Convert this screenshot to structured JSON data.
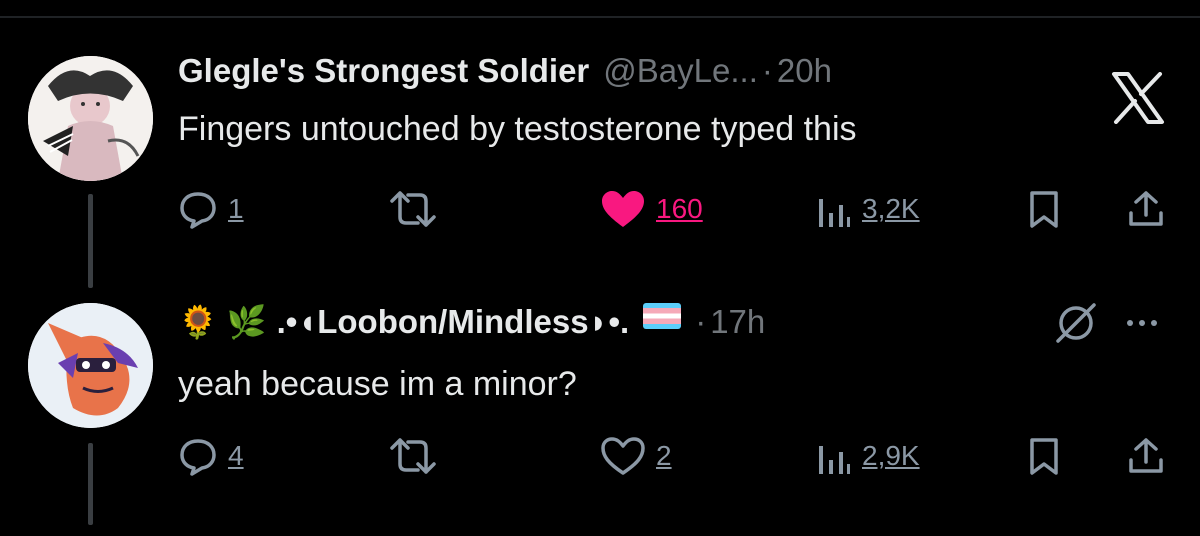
{
  "tweets": [
    {
      "author_name": "Glegle's Strongest Soldier",
      "handle": "@BayLe...",
      "separator": "·",
      "time": "20h",
      "text": "Fingers untouched by testosterone typed this",
      "replies": "1",
      "likes": "160",
      "liked": true,
      "views": "3,2K"
    },
    {
      "emoji_prefix": "🌻 🌿",
      "author_name": ".•◖Loobon/Mindless◗•.",
      "separator": "·",
      "time": "17h",
      "text": "yeah because im a minor?",
      "replies": "4",
      "likes": "2",
      "liked": false,
      "views": "2,9K"
    }
  ],
  "icons": {
    "reply": "speech-bubble-icon",
    "retweet": "retweet-icon",
    "like": "heart-icon",
    "views": "bar-chart-icon",
    "bookmark": "bookmark-icon",
    "share": "share-icon",
    "brand": "x-logo-icon",
    "mute": "slashed-circle-icon",
    "more": "ellipsis-icon"
  },
  "colors": {
    "background": "#000000",
    "text": "#e7e9ea",
    "muted": "#71767b",
    "action": "#8b98a5",
    "like_active": "#f91880"
  }
}
